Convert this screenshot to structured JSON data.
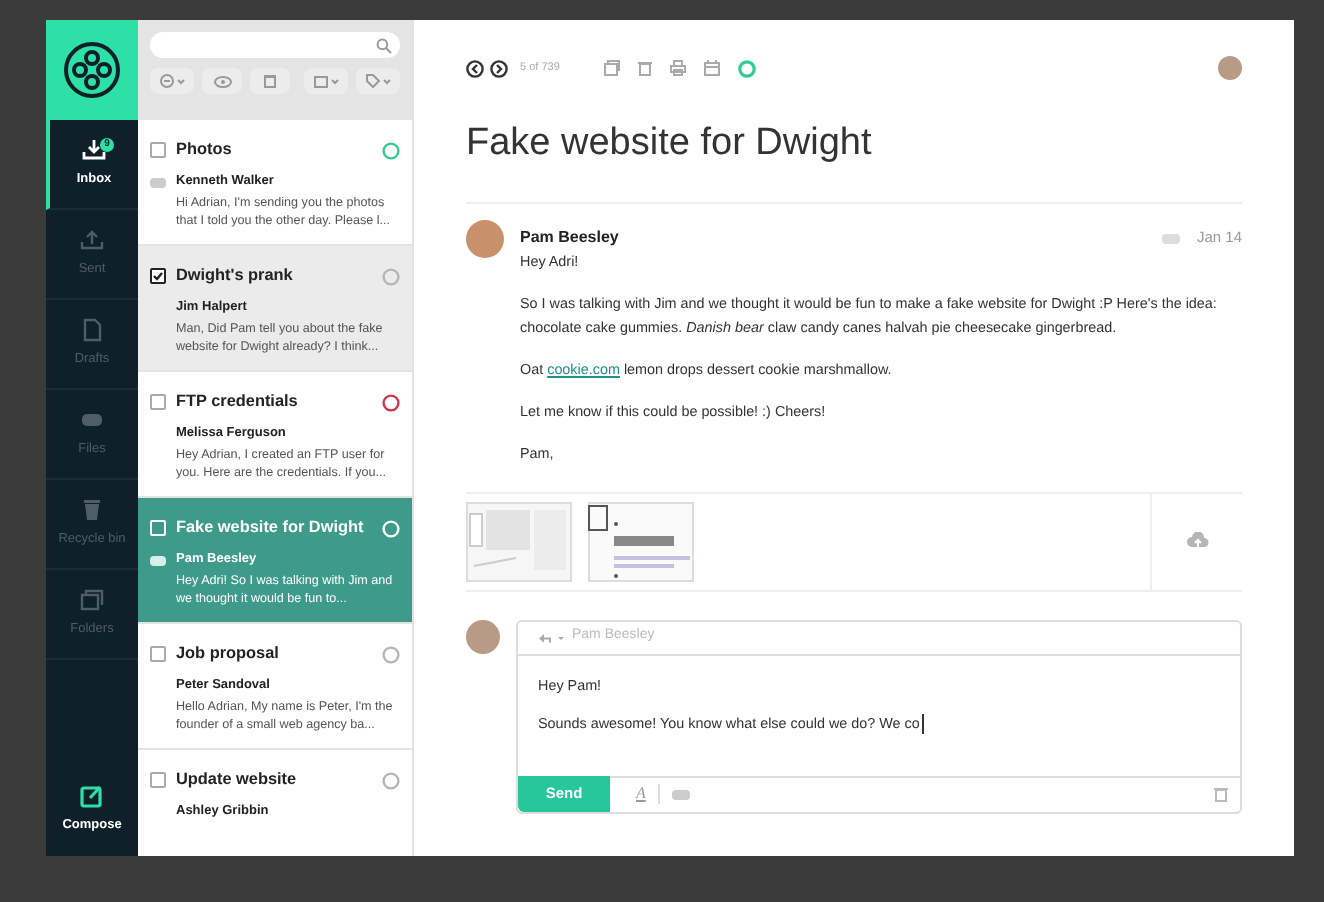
{
  "nav": {
    "items": [
      {
        "label": "Inbox",
        "badge": "9",
        "selected": true
      },
      {
        "label": "Sent",
        "selected": false
      },
      {
        "label": "Drafts",
        "selected": false
      },
      {
        "label": "Files",
        "selected": false
      },
      {
        "label": "Recycle bin",
        "selected": false
      },
      {
        "label": "Folders",
        "selected": false
      }
    ],
    "compose": "Compose"
  },
  "emails": [
    {
      "subject": "Photos",
      "sender": "Kenneth Walker",
      "preview": "Hi Adrian, I'm sending you the photos that I told you the other day. Please l...",
      "checked": false,
      "selected": false,
      "tagged": true,
      "color": "#2ecc8f"
    },
    {
      "subject": "Dwight's prank",
      "sender": "Jim Halpert",
      "preview": "Man, Did Pam tell you about the fake website for Dwight already? I think...",
      "checked": true,
      "selected": false,
      "tagged": false,
      "color": "#b5b5b5"
    },
    {
      "subject": "FTP credentials",
      "sender": "Melissa Ferguson",
      "preview": "Hey Adrian, I created an FTP user for you. Here are the credentials. If you...",
      "checked": false,
      "selected": false,
      "tagged": false,
      "color": "#d2334c"
    },
    {
      "subject": "Fake website for Dwight",
      "sender": "Pam Beesley",
      "preview": "Hey Adri! So I was talking with Jim and we thought it would be fun to...",
      "checked": false,
      "selected": true,
      "tagged": true,
      "color": "#ffffff"
    },
    {
      "subject": "Job proposal",
      "sender": "Peter Sandoval",
      "preview": "Hello Adrian, My name is Peter, I'm the founder of a small web agency ba...",
      "checked": false,
      "selected": false,
      "tagged": false,
      "color": "#b5b5b5"
    },
    {
      "subject": "Update website",
      "sender": "Ashley Gribbin",
      "checked": false,
      "selected": false,
      "tagged": false,
      "color": "#b5b5b5"
    }
  ],
  "toolbar": {
    "counter": "5 of 739"
  },
  "message": {
    "title": "Fake website for Dwight",
    "sender": "Pam Beesley",
    "date": "Jan 14",
    "body": [
      {
        "kind": "text",
        "text": "Hey Adri!"
      },
      {
        "kind": "text",
        "text": "So I was talking with Jim and we thought it would be fun to make a fake website for Dwight :P Here's the idea: chocolate cake gummies. *Danish bear* claw candy canes halvah pie cheesecake gingerbread."
      },
      {
        "kind": "link",
        "before": "Oat",
        "link": "cookie.com",
        "after": "lemon drops dessert cookie marshmallow."
      },
      {
        "kind": "text",
        "text": "Let me know if this could be possible! :) Cheers!"
      },
      {
        "kind": "text",
        "text": "Pam,"
      }
    ]
  },
  "reply": {
    "to": "Pam Beesley",
    "lines": [
      "Hey Pam!",
      "Sounds awesome! You know what else could we do? We co"
    ],
    "send": "Send",
    "format_icon": "A"
  }
}
